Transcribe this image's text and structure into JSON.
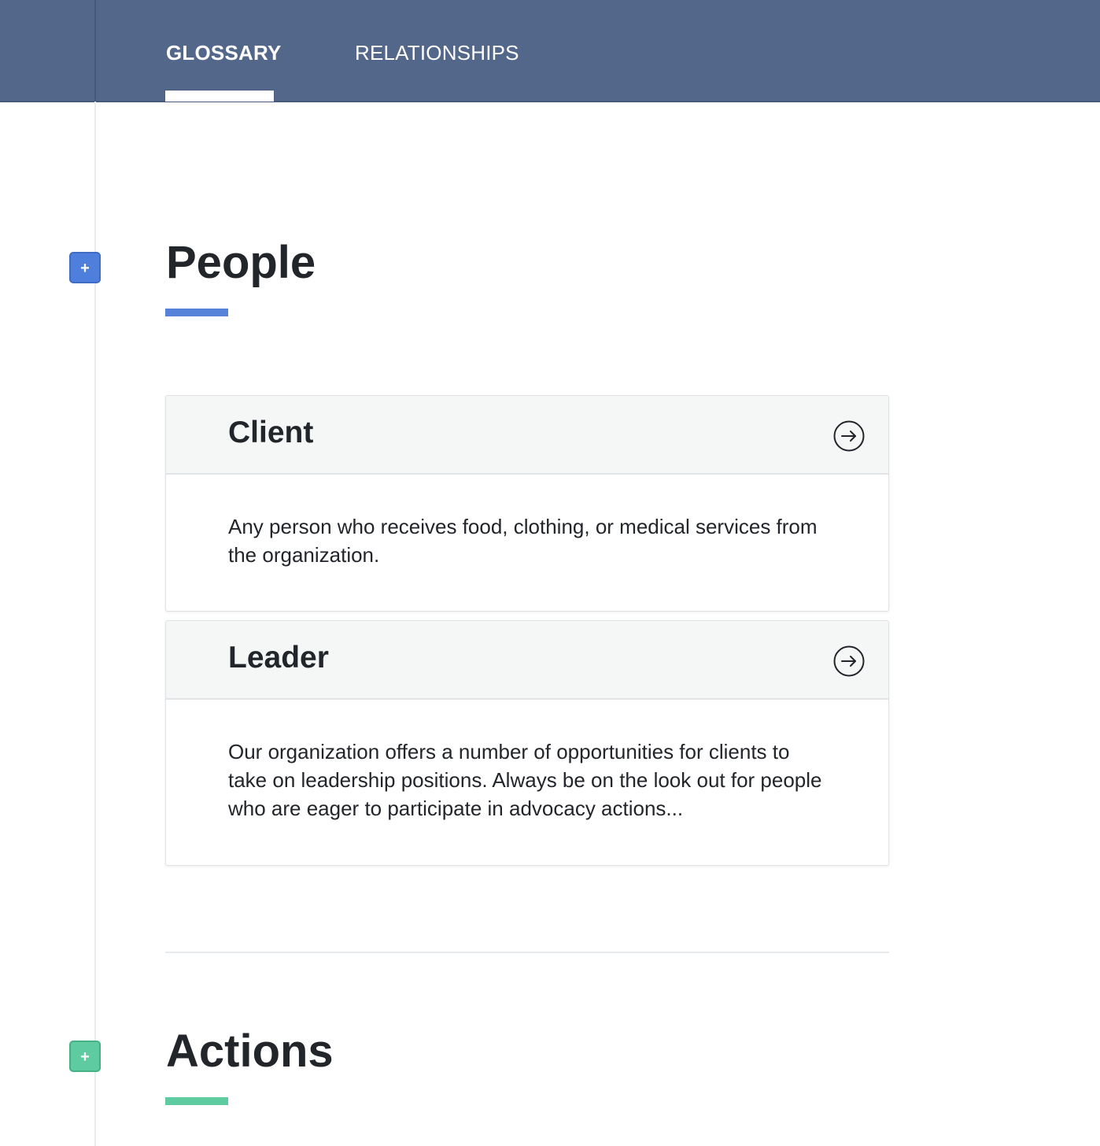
{
  "nav": {
    "tabs": [
      {
        "label": "GLOSSARY",
        "active": true
      },
      {
        "label": "RELATIONSHIPS",
        "active": false
      }
    ]
  },
  "sections": [
    {
      "title": "People",
      "accent": "#5683d9",
      "add_icon": "plus-icon",
      "add_symbol": "+",
      "cards": [
        {
          "title": "Client",
          "description": "Any person who receives food, clothing, or medical services from the organization.",
          "icon": "arrow-right-circle-icon"
        },
        {
          "title": "Leader",
          "description": "Our organization offers a number of opportunities for clients to take on leadership positions. Always be on the look out for people who are eager to participate in advocacy actions...",
          "icon": "arrow-right-circle-icon"
        }
      ]
    },
    {
      "title": "Actions",
      "accent": "#5ecba1",
      "add_icon": "plus-icon",
      "add_symbol": "+"
    }
  ],
  "colors": {
    "header_bg": "#53678a",
    "people_accent": "#5683d9",
    "actions_accent": "#5ecba1",
    "text": "#22252a",
    "card_header_bg": "#f5f7f6"
  }
}
